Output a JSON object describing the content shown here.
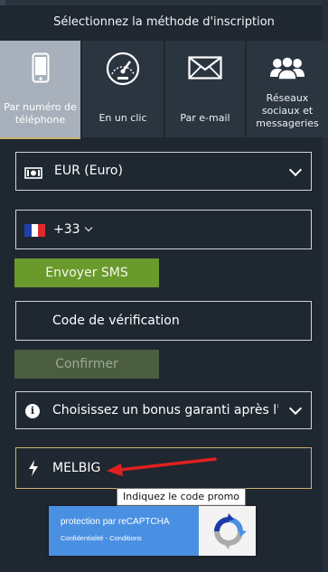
{
  "header": {
    "title": "Sélectionnez la méthode d'inscription"
  },
  "tabs": [
    {
      "label": "Par numéro de téléphone",
      "lines": [
        "Par numéro de",
        "téléphone"
      ],
      "icon": "phone-icon",
      "active": true
    },
    {
      "label": "En un clic",
      "lines": [
        "En un clic"
      ],
      "icon": "speedometer-icon",
      "active": false
    },
    {
      "label": "Par e-mail",
      "lines": [
        "Par e-mail"
      ],
      "icon": "envelope-icon",
      "active": false
    },
    {
      "label": "Réseaux sociaux et messageries",
      "lines": [
        "Réseaux",
        "sociaux et",
        "messageries"
      ],
      "icon": "users-icon",
      "active": false
    }
  ],
  "currency": {
    "value": "EUR (Euro)",
    "icon": "money-icon"
  },
  "phone": {
    "code": "+33",
    "flag": "france-flag-icon"
  },
  "sms_button": {
    "label": "Envoyer SMS"
  },
  "verification": {
    "placeholder": "Code de vérification"
  },
  "confirm_button": {
    "label": "Confirmer"
  },
  "bonus": {
    "value": "Choisissez un bonus garanti après l'ins",
    "icon": "info-icon"
  },
  "promo": {
    "value": "MELBIG",
    "icon": "lightning-icon",
    "tooltip": "Indiquez le code promo"
  },
  "recaptcha": {
    "title": "protection par reCAPTCHA",
    "links": "Confidentialité - Conditions",
    "icon": "recaptcha-icon"
  },
  "colors": {
    "background": "#1f2731",
    "tab": "#2b3540",
    "tab_active": "#a8b1bb",
    "accent_gold": "#cbb36c",
    "green": "#6a9a2c",
    "arrow": "#e02020"
  }
}
